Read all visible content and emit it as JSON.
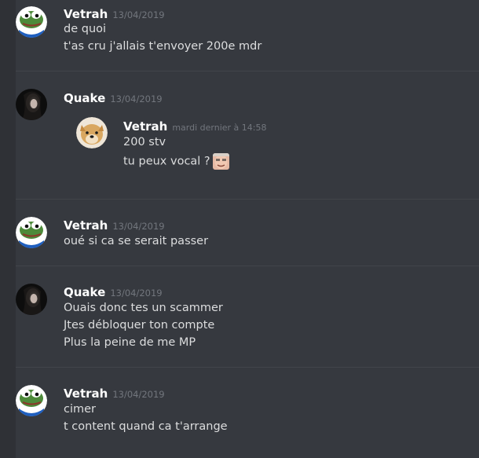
{
  "messages": [
    {
      "author": "Vetrah",
      "timestamp": "13/04/2019",
      "avatar": "pepe-avatar-icon",
      "lines": [
        "de quoi",
        "t'as cru j'allais t'envoyer 200e mdr"
      ]
    },
    {
      "author": "Quake",
      "timestamp": "13/04/2019",
      "avatar": "dark-portrait-avatar-icon",
      "quote": {
        "author": "Vetrah",
        "timestamp": "mardi dernier à 14:58",
        "avatar": "doge-avatar-icon",
        "lines": [
          "200 stv",
          "tu peux vocal ?"
        ],
        "emoji": "face-emoji-icon"
      }
    },
    {
      "author": "Vetrah",
      "timestamp": "13/04/2019",
      "avatar": "pepe-avatar-icon",
      "lines": [
        "oué si ca se serait passer"
      ]
    },
    {
      "author": "Quake",
      "timestamp": "13/04/2019",
      "avatar": "dark-portrait-avatar-icon",
      "lines": [
        "Ouais donc tes un scammer",
        "Jtes débloquer ton compte",
        "Plus la peine de me MP"
      ]
    },
    {
      "author": "Vetrah",
      "timestamp": "13/04/2019",
      "avatar": "pepe-avatar-icon",
      "lines": [
        "cimer",
        "t content quand ca t'arrange"
      ]
    }
  ],
  "colors": {
    "background": "#36393f",
    "username": "#ffffff",
    "text": "#dcddde",
    "timestamp": "#72767d"
  }
}
